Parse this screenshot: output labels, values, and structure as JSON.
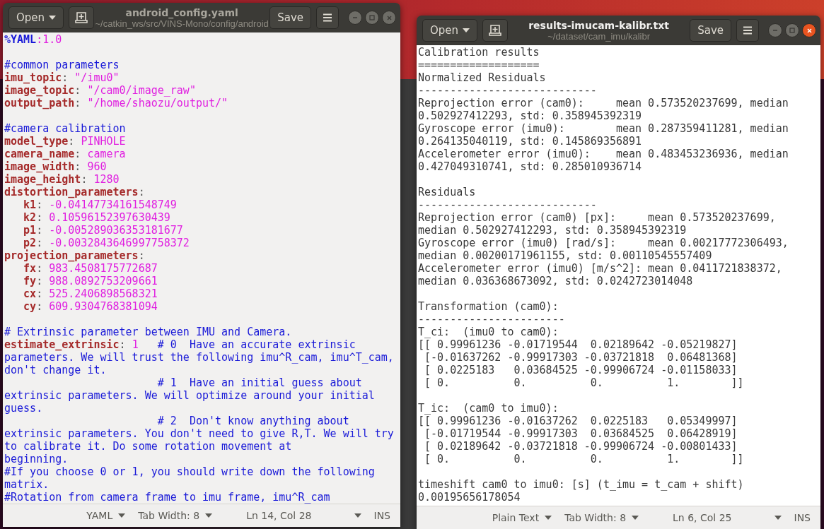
{
  "editor": {
    "active": false,
    "title": "android_config.yaml",
    "subtitle": "~/catkin_ws/src/VINS-Mono/config/android",
    "open": "Open",
    "save": "Save",
    "lines": [
      {
        "kind": "code",
        "segments": [
          {
            "kind": "directive",
            "text": "%YAML"
          },
          {
            "kind": "value",
            "text": ":1.0"
          }
        ]
      },
      {
        "kind": "blank"
      },
      {
        "kind": "code",
        "segments": [
          {
            "kind": "comment",
            "text": "#common parameters"
          }
        ]
      },
      {
        "kind": "code",
        "segments": [
          {
            "kind": "key",
            "text": "imu_topic"
          },
          {
            "kind": "punct",
            "text": ": "
          },
          {
            "kind": "value",
            "text": "\"/imu0\""
          }
        ]
      },
      {
        "kind": "code",
        "segments": [
          {
            "kind": "key",
            "text": "image_topic"
          },
          {
            "kind": "punct",
            "text": ": "
          },
          {
            "kind": "value",
            "text": "\"/cam0/image_raw\""
          }
        ]
      },
      {
        "kind": "code",
        "segments": [
          {
            "kind": "key",
            "text": "output_path"
          },
          {
            "kind": "punct",
            "text": ": "
          },
          {
            "kind": "value",
            "text": "\"/home/shaozu/output/\""
          }
        ]
      },
      {
        "kind": "blank"
      },
      {
        "kind": "code",
        "segments": [
          {
            "kind": "comment",
            "text": "#camera calibration"
          }
        ]
      },
      {
        "kind": "code",
        "segments": [
          {
            "kind": "key",
            "text": "model_type"
          },
          {
            "kind": "punct",
            "text": ": "
          },
          {
            "kind": "value",
            "text": "PINHOLE"
          }
        ]
      },
      {
        "kind": "code",
        "segments": [
          {
            "kind": "key",
            "text": "camera_name"
          },
          {
            "kind": "punct",
            "text": ": "
          },
          {
            "kind": "value",
            "text": "camera"
          }
        ]
      },
      {
        "kind": "code",
        "segments": [
          {
            "kind": "key",
            "text": "image_width"
          },
          {
            "kind": "punct",
            "text": ": "
          },
          {
            "kind": "value",
            "text": "960"
          }
        ]
      },
      {
        "kind": "code",
        "segments": [
          {
            "kind": "key",
            "text": "image_height"
          },
          {
            "kind": "punct",
            "text": ": "
          },
          {
            "kind": "value",
            "text": "1280"
          }
        ]
      },
      {
        "kind": "code",
        "segments": [
          {
            "kind": "key",
            "text": "distortion_parameters"
          },
          {
            "kind": "punct",
            "text": ":"
          }
        ]
      },
      {
        "kind": "code",
        "segments": [
          {
            "kind": "key",
            "text": "   k1"
          },
          {
            "kind": "punct",
            "text": ": "
          },
          {
            "kind": "value",
            "text": "-0.04147734161548749"
          }
        ]
      },
      {
        "kind": "code",
        "segments": [
          {
            "kind": "key",
            "text": "   k2"
          },
          {
            "kind": "punct",
            "text": ": "
          },
          {
            "kind": "value",
            "text": "0.10596152397630439"
          }
        ]
      },
      {
        "kind": "code",
        "segments": [
          {
            "kind": "key",
            "text": "   p1"
          },
          {
            "kind": "punct",
            "text": ": "
          },
          {
            "kind": "value",
            "text": "-0.005289036353181677"
          }
        ]
      },
      {
        "kind": "code",
        "segments": [
          {
            "kind": "key",
            "text": "   p2"
          },
          {
            "kind": "punct",
            "text": ": "
          },
          {
            "kind": "value",
            "text": "-0.0032843646997758372"
          }
        ]
      },
      {
        "kind": "code",
        "segments": [
          {
            "kind": "key",
            "text": "projection_parameters"
          },
          {
            "kind": "punct",
            "text": ":"
          }
        ]
      },
      {
        "kind": "code",
        "segments": [
          {
            "kind": "key",
            "text": "   fx"
          },
          {
            "kind": "punct",
            "text": ": "
          },
          {
            "kind": "value",
            "text": "983.4508175772687"
          }
        ]
      },
      {
        "kind": "code",
        "segments": [
          {
            "kind": "key",
            "text": "   fy"
          },
          {
            "kind": "punct",
            "text": ": "
          },
          {
            "kind": "value",
            "text": "988.0892753209661"
          }
        ]
      },
      {
        "kind": "code",
        "segments": [
          {
            "kind": "key",
            "text": "   cx"
          },
          {
            "kind": "punct",
            "text": ": "
          },
          {
            "kind": "value",
            "text": "525.2406898568321"
          }
        ]
      },
      {
        "kind": "code",
        "segments": [
          {
            "kind": "key",
            "text": "   cy"
          },
          {
            "kind": "punct",
            "text": ": "
          },
          {
            "kind": "value",
            "text": "609.9304768381094"
          }
        ]
      },
      {
        "kind": "blank"
      },
      {
        "kind": "code",
        "segments": [
          {
            "kind": "comment",
            "text": "# Extrinsic parameter between IMU and Camera."
          }
        ]
      },
      {
        "kind": "code",
        "segments": [
          {
            "kind": "key",
            "text": "estimate_extrinsic"
          },
          {
            "kind": "punct",
            "text": ": "
          },
          {
            "kind": "value",
            "text": "1"
          },
          {
            "kind": "comment",
            "text": "   # 0  Have an accurate extrinsic"
          }
        ]
      },
      {
        "kind": "code",
        "segments": [
          {
            "kind": "comment",
            "text": "parameters. We will trust the following imu^R_cam, imu^T_cam,"
          }
        ]
      },
      {
        "kind": "code",
        "segments": [
          {
            "kind": "comment",
            "text": "don't change it."
          }
        ]
      },
      {
        "kind": "code",
        "segments": [
          {
            "kind": "comment",
            "text": "                        # 1  Have an initial guess about"
          }
        ]
      },
      {
        "kind": "code",
        "segments": [
          {
            "kind": "comment",
            "text": "extrinsic parameters. We will optimize around your initial"
          }
        ]
      },
      {
        "kind": "code",
        "segments": [
          {
            "kind": "comment",
            "text": "guess."
          }
        ]
      },
      {
        "kind": "code",
        "segments": [
          {
            "kind": "comment",
            "text": "                        # 2  Don't know anything about"
          }
        ]
      },
      {
        "kind": "code",
        "segments": [
          {
            "kind": "comment",
            "text": "extrinsic parameters. You don't need to give R,T. We will try"
          }
        ]
      },
      {
        "kind": "code",
        "segments": [
          {
            "kind": "comment",
            "text": "to calibrate it. Do some rotation movement at"
          }
        ]
      },
      {
        "kind": "code",
        "segments": [
          {
            "kind": "comment",
            "text": "beginning."
          }
        ]
      },
      {
        "kind": "code",
        "segments": [
          {
            "kind": "comment",
            "text": "#If you choose 0 or 1, you should write down the following"
          }
        ]
      },
      {
        "kind": "code",
        "segments": [
          {
            "kind": "comment",
            "text": "matrix."
          }
        ]
      },
      {
        "kind": "code",
        "segments": [
          {
            "kind": "comment",
            "text": "#Rotation from camera frame to imu frame, imu^R_cam"
          }
        ]
      }
    ],
    "status": [
      {
        "kind": "dropdown",
        "text": "YAML"
      },
      {
        "kind": "dropdown",
        "text": "Tab Width: 8"
      },
      {
        "kind": "position",
        "text": "Ln 14, Col 28"
      },
      {
        "kind": "plain",
        "text": "INS"
      }
    ]
  },
  "results": {
    "active": true,
    "title": "results-imucam-kalibr.txt",
    "subtitle": "~/dataset/cam_imu/kalibr",
    "open": "Open",
    "save": "Save",
    "lines": [
      {
        "kind": "text",
        "text": "Calibration results"
      },
      {
        "kind": "text",
        "text": "==================="
      },
      {
        "kind": "text",
        "text": "Normalized Residuals"
      },
      {
        "kind": "text",
        "text": "----------------------------"
      },
      {
        "kind": "text",
        "text": "Reprojection error (cam0):     mean 0.573520237699, median"
      },
      {
        "kind": "text",
        "text": "0.502927412293, std: 0.358945392319"
      },
      {
        "kind": "text",
        "text": "Gyroscope error (imu0):        mean 0.287359411281, median"
      },
      {
        "kind": "text",
        "text": "0.264135040119, std: 0.145869356891"
      },
      {
        "kind": "text",
        "text": "Accelerometer error (imu0):    mean 0.483453236936, median"
      },
      {
        "kind": "text",
        "text": "0.427049310741, std: 0.285010936714"
      },
      {
        "kind": "blank"
      },
      {
        "kind": "text",
        "text": "Residuals"
      },
      {
        "kind": "text",
        "text": "----------------------------"
      },
      {
        "kind": "text",
        "text": "Reprojection error (cam0) [px]:     mean 0.573520237699,"
      },
      {
        "kind": "text",
        "text": "median 0.502927412293, std: 0.358945392319"
      },
      {
        "kind": "text",
        "text": "Gyroscope error (imu0) [rad/s]:     mean 0.00217772306493,"
      },
      {
        "kind": "text",
        "text": "median 0.00200171961155, std: 0.00110545557409"
      },
      {
        "kind": "text",
        "text": "Accelerometer error (imu0) [m/s^2]: mean 0.0411721838372,"
      },
      {
        "kind": "text",
        "text": "median 0.036368673092, std: 0.0242723014048"
      },
      {
        "kind": "blank"
      },
      {
        "kind": "text",
        "text": "Transformation (cam0):"
      },
      {
        "kind": "text",
        "text": "-----------------------"
      },
      {
        "kind": "text",
        "text": "T_ci:  (imu0 to cam0):"
      },
      {
        "kind": "text",
        "text": "[[ 0.99961236 -0.01719544  0.02189642 -0.05219827]"
      },
      {
        "kind": "text",
        "text": " [-0.01637262 -0.99917303 -0.03721818  0.06481368]"
      },
      {
        "kind": "text",
        "text": " [ 0.0225183   0.03684525 -0.99906724 -0.01158033]"
      },
      {
        "kind": "text",
        "text": " [ 0.          0.          0.          1.        ]]"
      },
      {
        "kind": "blank"
      },
      {
        "kind": "text",
        "text": "T_ic:  (cam0 to imu0):"
      },
      {
        "kind": "text",
        "text": "[[ 0.99961236 -0.01637262  0.0225183   0.05349997]"
      },
      {
        "kind": "text",
        "text": " [-0.01719544 -0.99917303  0.03684525  0.06428919]"
      },
      {
        "kind": "text",
        "text": " [ 0.02189642 -0.03721818 -0.99906724 -0.00801433]"
      },
      {
        "kind": "text",
        "text": " [ 0.          0.          0.          1.        ]]"
      },
      {
        "kind": "blank"
      },
      {
        "kind": "text",
        "text": "timeshift cam0 to imu0: [s] (t_imu = t_cam + shift)"
      },
      {
        "kind": "text",
        "text": "0.00195656178054"
      }
    ],
    "status": [
      {
        "kind": "dropdown",
        "text": "Plain Text"
      },
      {
        "kind": "dropdown",
        "text": "Tab Width: 8"
      },
      {
        "kind": "position",
        "text": "Ln 6, Col 25"
      },
      {
        "kind": "plain",
        "text": "INS"
      }
    ]
  }
}
